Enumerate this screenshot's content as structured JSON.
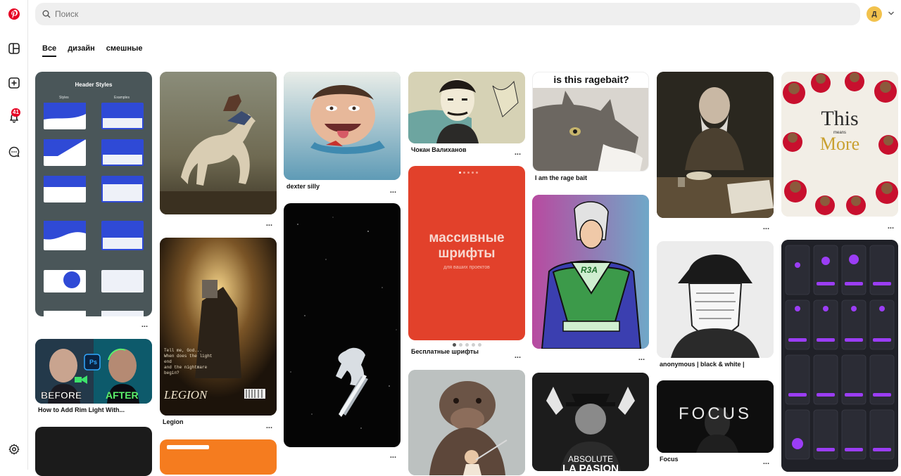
{
  "sidebar": {
    "items": [
      {
        "name": "pinterest-logo-icon"
      },
      {
        "name": "home-grid-icon"
      },
      {
        "name": "create-icon"
      },
      {
        "name": "notifications-icon",
        "badge": "41"
      },
      {
        "name": "messages-icon"
      },
      {
        "name": "settings-icon"
      }
    ]
  },
  "search": {
    "placeholder": "Поиск"
  },
  "account": {
    "initial": "Д"
  },
  "tabs": [
    {
      "label": "Все",
      "active": true
    },
    {
      "label": "дизайн",
      "active": false
    },
    {
      "label": "смешные",
      "active": false
    }
  ],
  "pins": {
    "header_styles": {
      "title": "",
      "text_title": "Header Styles",
      "text_styles": "Styles",
      "text_examples": "Examples"
    },
    "rim_light": {
      "title": "How to Add Rim Light With...",
      "before": "BEFORE",
      "after": "AFTER",
      "ps": "Ps"
    },
    "horse": {
      "title": ""
    },
    "legion": {
      "title": "Legion",
      "poster_word": "LEGION",
      "poster_lines": [
        "Tell me, God...",
        "When does the light",
        "end",
        "and the nightmare",
        "begin?"
      ]
    },
    "dexter": {
      "title": "dexter silly"
    },
    "surfer": {
      "title": ""
    },
    "chokan": {
      "title": "Чокан Валиханов"
    },
    "fonts": {
      "title": "Бесплатные шрифты",
      "big1": "массивные",
      "big2": "шрифты",
      "small": "для ваших проектов"
    },
    "dog": {
      "title": ""
    },
    "ragebait": {
      "title": "I am the rage bait",
      "caption": "is this ragebait?"
    },
    "superhero": {
      "title": "",
      "emblem": "R3A"
    },
    "absolute": {
      "title": "",
      "line1": "ABSOLUTE",
      "line2": "LA PASION"
    },
    "old_man": {
      "title": ""
    },
    "anonymous": {
      "title": "anonymous | black & white |"
    },
    "focus": {
      "title": "Focus",
      "word": "FOCUS"
    },
    "this_means_more": {
      "title": "",
      "line1": "This",
      "line2": "means",
      "line3": "More"
    },
    "app_ui": {
      "title": ""
    }
  },
  "more_label": "...",
  "colors": {
    "brand": "#e60023",
    "avatar": "#f2c24d",
    "search_bg": "#efefef"
  }
}
